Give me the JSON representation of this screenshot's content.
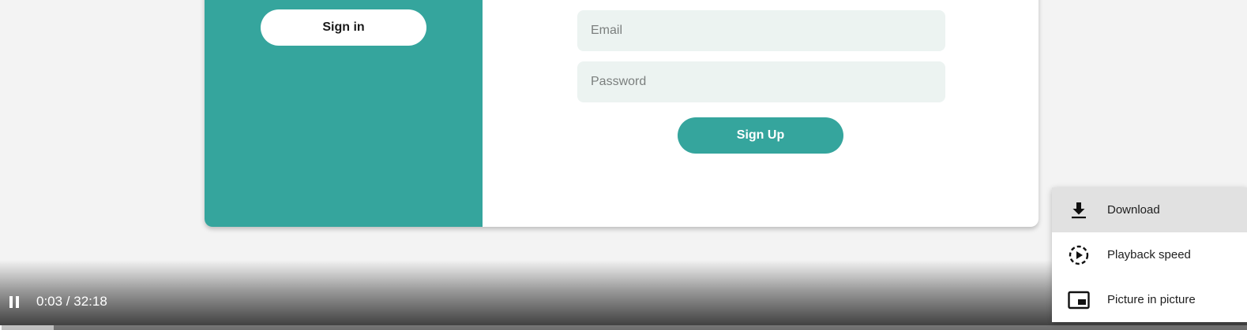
{
  "form": {
    "signin_label": "Sign in",
    "email_placeholder": "Email",
    "password_placeholder": "Password",
    "signup_label": "Sign Up"
  },
  "player": {
    "current_time": "0:03",
    "duration": "32:18",
    "time_display": "0:03 / 32:18",
    "progress_fraction": 0.0015,
    "buffered_fraction": 0.043,
    "state_icon": "pause-icon"
  },
  "menu": {
    "items": [
      {
        "label": "Download",
        "icon": "download-icon",
        "highlighted": true
      },
      {
        "label": "Playback speed",
        "icon": "playback-speed-icon",
        "highlighted": false
      },
      {
        "label": "Picture in picture",
        "icon": "picture-in-picture-icon",
        "highlighted": false
      }
    ]
  },
  "colors": {
    "accent_teal": "#35a59d",
    "input_background": "#ecf3f1",
    "page_background": "#f3f3f3",
    "menu_highlight": "#e1e1e1"
  }
}
